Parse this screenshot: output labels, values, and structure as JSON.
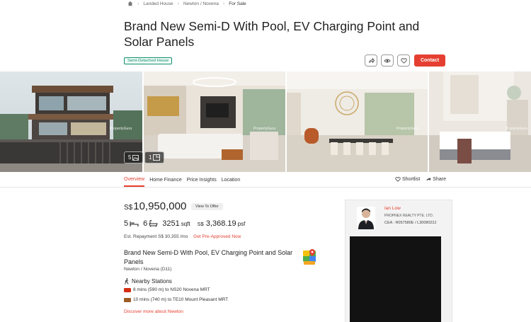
{
  "breadcrumb": {
    "items": [
      "Landed House",
      "Newton / Novena",
      "For Sale"
    ]
  },
  "listing": {
    "title": "Brand New Semi-D With Pool, EV Charging Point and Solar Panels",
    "type_badge": "Semi-Detached House",
    "contact_label": "Contact",
    "price_currency": "S$",
    "price_value": "10,950,000",
    "view_offer_label": "View To Offer",
    "beds": "5",
    "baths": "6",
    "area_value": "3251",
    "area_unit": "sqft",
    "psf_currency": "S$",
    "psf_value": "3,368.19",
    "psf_unit": "psf",
    "repayment_text": "Est. Repayment S$ 30,355 /mo",
    "pre_approved_link": "Get Pre-Approved Now",
    "sub_title": "Brand New Semi-D With Pool, EV Charging Point and Solar Panels",
    "district": "Newton / Novena (D11)"
  },
  "gallery": {
    "watermark": "PropertyGuru",
    "photo_count": "5",
    "floorplan_count": "1"
  },
  "tabs": [
    "Overview",
    "Home Finance",
    "Price Insights",
    "Location"
  ],
  "actions": {
    "shortlist": "Shortlist",
    "share": "Share"
  },
  "nearby": {
    "title": "Nearby Stations",
    "stations": [
      {
        "text": "8 mins (590 m) to NS20 Novena MRT",
        "color": "#d42e12"
      },
      {
        "text": "10 mins (740 m) to TE10 Mount Pleasant MRT",
        "color": "#9d5b25"
      }
    ],
    "discover_link": "Discover more about Newton"
  },
  "agent": {
    "name": "Ian Low",
    "agency": "PROPNEX REALTY PTE. LTD.",
    "cea": "CEA : R057580E / L3008022J"
  },
  "colors": {
    "accent": "#e53f31",
    "badge": "#0f8f6a"
  }
}
